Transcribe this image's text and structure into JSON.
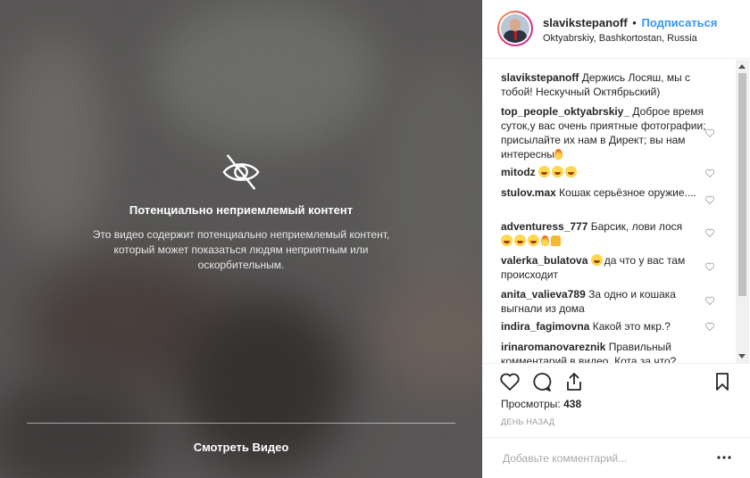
{
  "media": {
    "warning_title": "Потенциально неприемлемый контент",
    "warning_text": "Это видео содержит потенциально неприемлемый контент, который может показаться людям неприятным или оскорбительным.",
    "watch_label": "Смотреть Видео",
    "icon": "eye-crossed-icon"
  },
  "header": {
    "username": "slavikstepanoff",
    "separator": "•",
    "follow_label": "Подписаться",
    "location": "Oktyabrskiy, Bashkortostan, Russia"
  },
  "comments": [
    {
      "user": "slavikstepanoff",
      "text": "Держись Лосяш, мы с тобой! Нескучный Октябрьский)"
    },
    {
      "user": "top_people_oktyabrskiy_",
      "text": "Доброе время суток,у вас очень приятные фотографии; присылайте их нам в Директ; вы нам интересны",
      "emoji": [
        "fire"
      ]
    },
    {
      "user": "mitodz",
      "text": "",
      "emoji": [
        "grin",
        "grin",
        "grin"
      ]
    },
    {
      "user": "stulov.max",
      "text": "Кошак серьёзное оружие...."
    },
    {
      "user": "adventuress_777",
      "text": "Барсик, лови лося",
      "emoji": [
        "grin",
        "grin",
        "grin",
        "fire",
        "thumbs-up"
      ]
    },
    {
      "user": "valerka_bulatova",
      "text": "да что у вас там происходит",
      "emoji_before": [
        "grin"
      ]
    },
    {
      "user": "anita_valieva789",
      "text": "За одно и кошака выгнали из дома"
    },
    {
      "user": "indira_fagimovna",
      "text": "Какой это мкр.?"
    },
    {
      "user": "irinaromanovareznik",
      "text": "Правильный комментарий в видео. Кота за что?"
    }
  ],
  "stats": {
    "views_label": "Просмотры:",
    "views_count": "438",
    "time": "ДЕНЬ НАЗАД"
  },
  "compose": {
    "placeholder": "Добавьте комментарий..."
  },
  "colors": {
    "accent": "#3897f0",
    "text": "#262626",
    "muted": "#999999"
  }
}
